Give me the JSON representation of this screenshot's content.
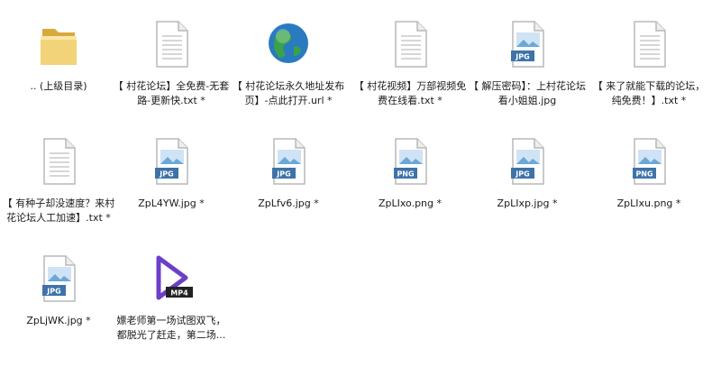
{
  "items": [
    {
      "label": ".. (上级目录)",
      "icon": "folder-icon"
    },
    {
      "label": "【 村花论坛】全免费-无套路-更新快.txt *",
      "icon": "text-file-icon"
    },
    {
      "label": "【 村花论坛永久地址发布页】-点此打开.url *",
      "icon": "globe-icon"
    },
    {
      "label": "【 村花视频】万部视频免费在线看.txt *",
      "icon": "text-file-icon"
    },
    {
      "label": "【 解压密码】：上村花论坛看小姐姐.jpg",
      "icon": "jpg-file-icon",
      "badge": "JPG"
    },
    {
      "label": "【 来了就能下载的论坛，纯免费！】.txt *",
      "icon": "text-file-icon"
    },
    {
      "label": "【 有种子却没速度？来村花论坛人工加速】.txt *",
      "icon": "text-file-icon"
    },
    {
      "label": "ZpL4YW.jpg *",
      "icon": "jpg-file-icon",
      "badge": "JPG"
    },
    {
      "label": "ZpLfv6.jpg *",
      "icon": "jpg-file-icon",
      "badge": "JPG"
    },
    {
      "label": "ZpLIxo.png *",
      "icon": "png-file-icon",
      "badge": "PNG"
    },
    {
      "label": "ZpLIxp.jpg *",
      "icon": "jpg-file-icon",
      "badge": "JPG"
    },
    {
      "label": "ZpLIxu.png *",
      "icon": "png-file-icon",
      "badge": "PNG"
    },
    {
      "label": "ZpLjWK.jpg *",
      "icon": "jpg-file-icon",
      "badge": "JPG"
    },
    {
      "label": "嫖老师第一场试图双飞，都脱光了赶走，第二场...",
      "icon": "mp4-file-icon",
      "badge": "MP4"
    }
  ],
  "colors": {
    "folder": "#e8c25a",
    "badge_blue": "#3e73a8",
    "play_purple": "#6b3fc7"
  }
}
